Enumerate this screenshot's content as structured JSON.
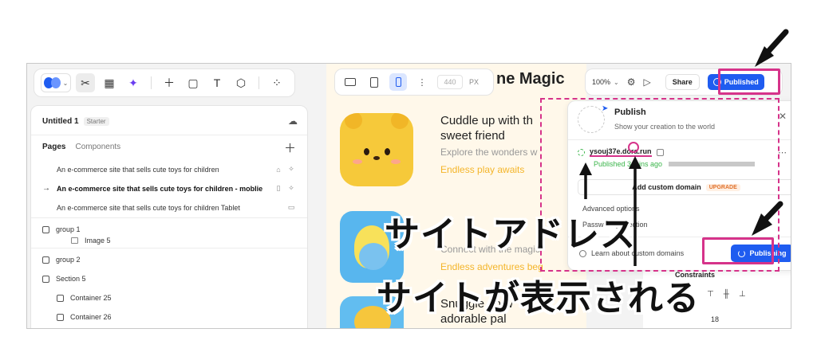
{
  "left_panel": {
    "project_title": "Untitled 1",
    "project_badge": "Starter",
    "tabs": [
      "Pages",
      "Components"
    ],
    "pages": [
      {
        "label": "An e-commerce site that sells cute toys for children",
        "icon": "home-icon",
        "current": false
      },
      {
        "label": "An e-commerce site that sells cute toys for children - moblie",
        "icon": "mobile-icon",
        "current": true
      },
      {
        "label": "An e-commerce site that sells cute toys for children Tablet",
        "icon": "tablet-icon",
        "current": false
      }
    ],
    "layers": [
      "group 1",
      "Image 5",
      "group 2",
      "Section 5",
      "Container 25",
      "Container 26"
    ]
  },
  "canvas": {
    "width_placeholder": "440",
    "unit": "PX",
    "site": {
      "heading": "ne Magic",
      "card1_title": "Cuddle up with th",
      "card1_title2": "sweet friend",
      "card1_sub": "Explore the wonders w",
      "card1_accent": "Endless play awaits",
      "card2_sub": "Connect with the magic",
      "card2_accent": "Endless adventures beg",
      "card3_title": "Snuggle up w",
      "card3_title2": "adorable pal"
    }
  },
  "top_bar": {
    "zoom": "100%",
    "share_label": "Share",
    "published_label": "Published"
  },
  "properties": {
    "title": "Constraints",
    "value": "18"
  },
  "publish_popup": {
    "title": "Publish",
    "subtitle": "Show your creation to the world",
    "url": "ysouj37e.dora.run",
    "published_time": "Published 3 mins ago",
    "custom_domain_label": "Add custom domain",
    "upgrade_badge": "UPGRADE",
    "advanced_options": "Advanced options",
    "password_protection": "Password protection",
    "learn_label": "Learn about custom domains",
    "publishing_label": "Publishing"
  },
  "annotations": {
    "site_address": "サイトアドレス",
    "site_shown": "サイトが表示される"
  },
  "colors": {
    "accent": "#1f5cf0",
    "highlight": "#d6338a",
    "success": "#3ab54a"
  }
}
